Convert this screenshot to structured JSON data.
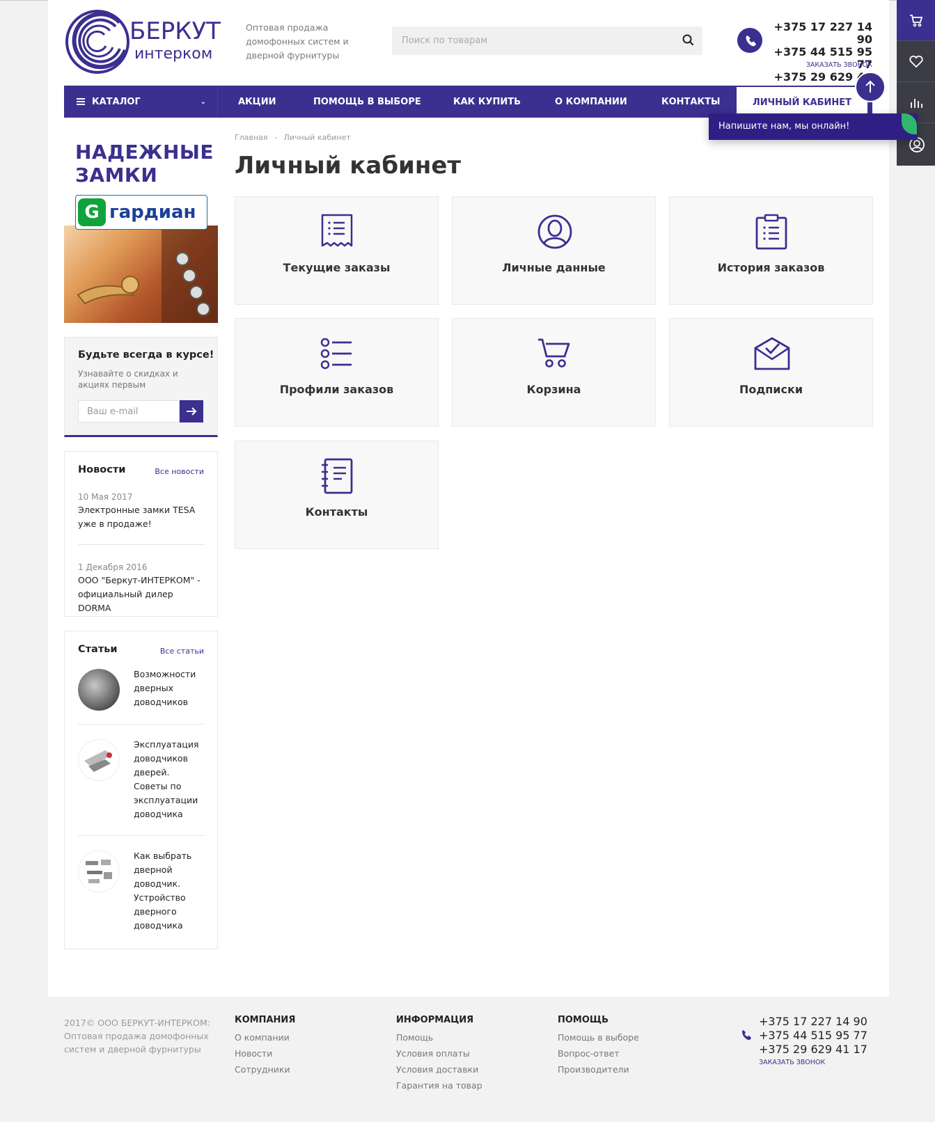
{
  "header": {
    "logo_line1": "БЕРКУТ",
    "logo_line2": "интерком",
    "slogan": "Оптовая продажа домофонных систем и дверной фурнитуры",
    "search_placeholder": "Поиск по товарам",
    "phones": [
      "+375 17 227 14 90",
      "+375 44 515 95 77",
      "+375 29 629 41 17"
    ],
    "callback": "ЗАКАЗАТЬ ЗВОНОК"
  },
  "nav": {
    "catalog": "КАТАЛОГ",
    "items": [
      "АКЦИИ",
      "ПОМОЩЬ В ВЫБОРЕ",
      "КАК КУПИТЬ",
      "О КОМПАНИИ",
      "КОНТАКТЫ",
      "ЛИЧНЫЙ КАБИНЕТ"
    ]
  },
  "chat": {
    "text": "Напишите нам, мы онлайн!"
  },
  "banner": {
    "title_line1": "НАДЕЖНЫЕ",
    "title_line2": "ЗАМКИ",
    "brand": "гардиан",
    "brand_letter": "G"
  },
  "subscribe": {
    "title": "Будьте всегда в курсе!",
    "desc": "Узнавайте о скидках и акциях первым",
    "placeholder": "Ваш e-mail"
  },
  "news": {
    "title": "Новости",
    "all": "Все новости",
    "items": [
      {
        "date": "10 Мая 2017",
        "text": "Электронные замки TESA уже в продаже!"
      },
      {
        "date": "1 Декабря 2016",
        "text": "ООО \"Беркут-ИНТЕРКОМ\" - официальный дилер DORMA"
      }
    ]
  },
  "articles": {
    "title": "Статьи",
    "all": "Все статьи",
    "items": [
      "Возможности дверных доводчиков",
      "Эксплуатация доводчиков дверей. Советы по эксплуатации доводчика",
      "Как выбрать дверной доводчик. Устройство дверного доводчика"
    ]
  },
  "main": {
    "breadcrumb": [
      "Главная",
      "-",
      "Личный кабинет"
    ],
    "title": "Личный кабинет",
    "cards": [
      {
        "label": "Текущие заказы",
        "icon": "receipt-icon"
      },
      {
        "label": "Личные данные",
        "icon": "user-icon"
      },
      {
        "label": "История заказов",
        "icon": "clipboard-icon"
      },
      {
        "label": "Профили заказов",
        "icon": "list-icon"
      },
      {
        "label": "Корзина",
        "icon": "cart-icon"
      },
      {
        "label": "Подписки",
        "icon": "mail-icon"
      },
      {
        "label": "Контакты",
        "icon": "notebook-icon"
      }
    ]
  },
  "footer": {
    "copyright": "2017© ООО БЕРКУТ-ИНТЕРКОМ: Оптовая продажа домофонных систем и дверной фурнитуры",
    "columns": [
      {
        "title": "КОМПАНИЯ",
        "links": [
          "О компании",
          "Новости",
          "Сотрудники"
        ]
      },
      {
        "title": "ИНФОРМАЦИЯ",
        "links": [
          "Помощь",
          "Условия оплаты",
          "Условия доставки",
          "Гарантия на товар"
        ]
      },
      {
        "title": "ПОМОЩЬ",
        "links": [
          "Помощь в выборе",
          "Вопрос-ответ",
          "Производители"
        ]
      }
    ],
    "phones": [
      "+375 17 227 14 90",
      "+375 44 515 95 77",
      "+375 29 629 41 17"
    ],
    "callback": "ЗАКАЗАТЬ ЗВОНОК"
  },
  "colors": {
    "brand": "#3b2f8f",
    "chat_bg": "#2f1f84",
    "accent_green": "#2fb86b"
  }
}
